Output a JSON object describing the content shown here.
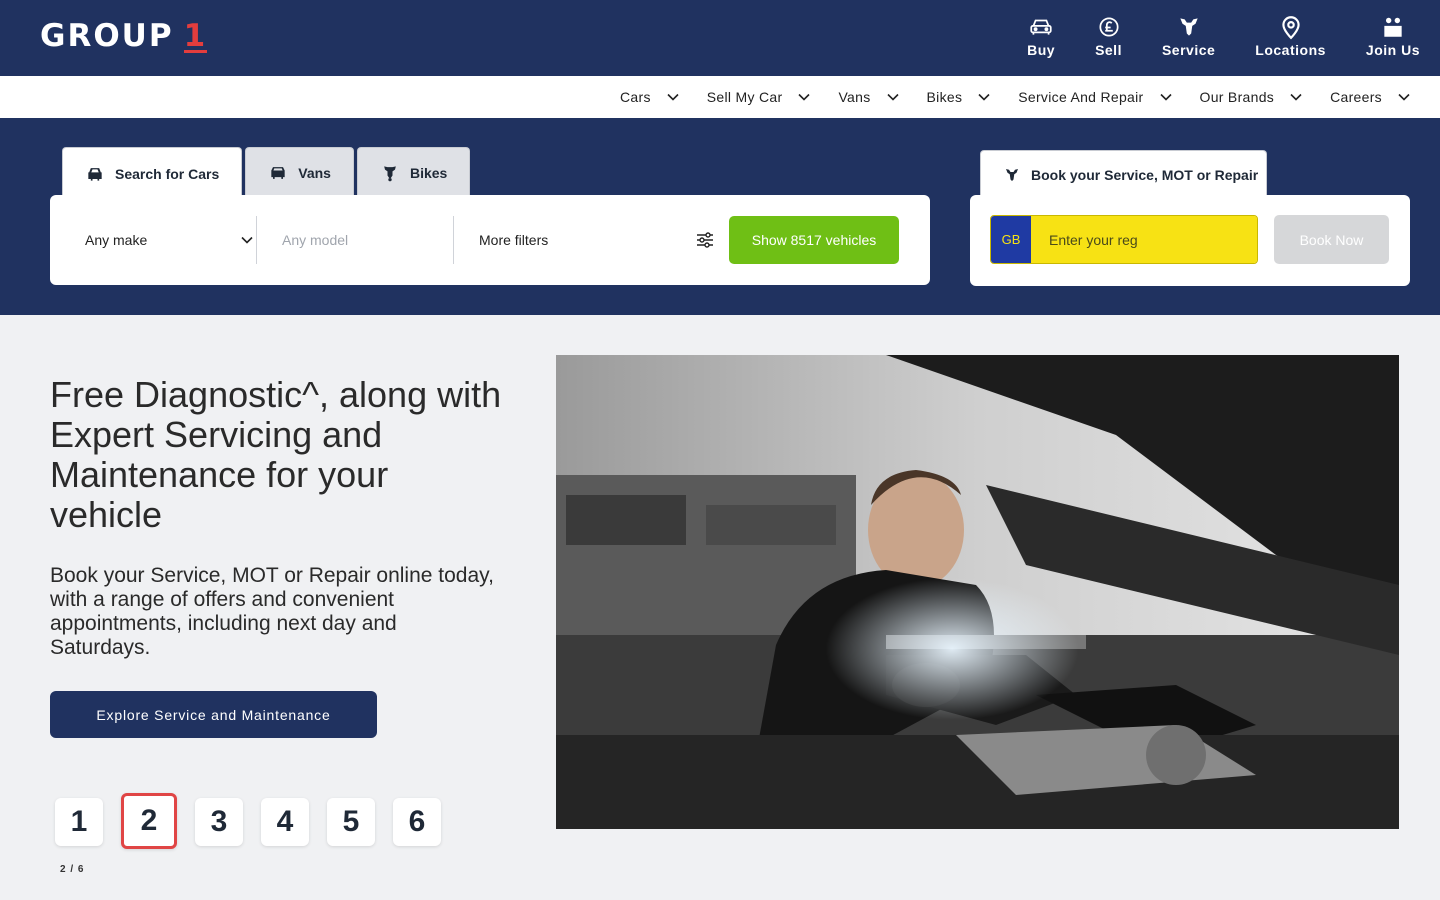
{
  "brand": {
    "logo_text": "GROUP",
    "logo_num": "1"
  },
  "topnav": [
    {
      "label": "Buy",
      "icon": "car-icon"
    },
    {
      "label": "Sell",
      "icon": "pound-car-icon"
    },
    {
      "label": "Service",
      "icon": "service-icon"
    },
    {
      "label": "Locations",
      "icon": "location-pin-icon"
    },
    {
      "label": "Join Us",
      "icon": "people-icon"
    }
  ],
  "subnav": [
    "Cars",
    "Sell My Car",
    "Vans",
    "Bikes",
    "Service And Repair",
    "Our Brands",
    "Careers"
  ],
  "search": {
    "tabs": [
      "Search for Cars",
      "Vans",
      "Bikes"
    ],
    "make": "Any make",
    "model_placeholder": "Any model",
    "more_filters": "More filters",
    "show_button": "Show 8517 vehicles"
  },
  "booking": {
    "tab_label": "Book your Service, MOT or Repair",
    "country": "GB",
    "reg_placeholder": "Enter your reg",
    "button": "Book Now"
  },
  "hero": {
    "headline": "Free Diagnostic^, along with Expert Servicing and Maintenance for your vehicle",
    "lede": "Book your Service, MOT or Repair online today, with a range of offers and convenient appointments, including next day and Saturdays.",
    "cta": "Explore Service and Maintenance"
  },
  "carousel": {
    "pages": [
      "1",
      "2",
      "3",
      "4",
      "5",
      "6"
    ],
    "active": 2,
    "count_label": "2 / 6"
  },
  "colors": {
    "navy": "#203260",
    "green": "#6fbf15",
    "reg_yellow": "#f7e214",
    "accent_red": "#e04545"
  }
}
